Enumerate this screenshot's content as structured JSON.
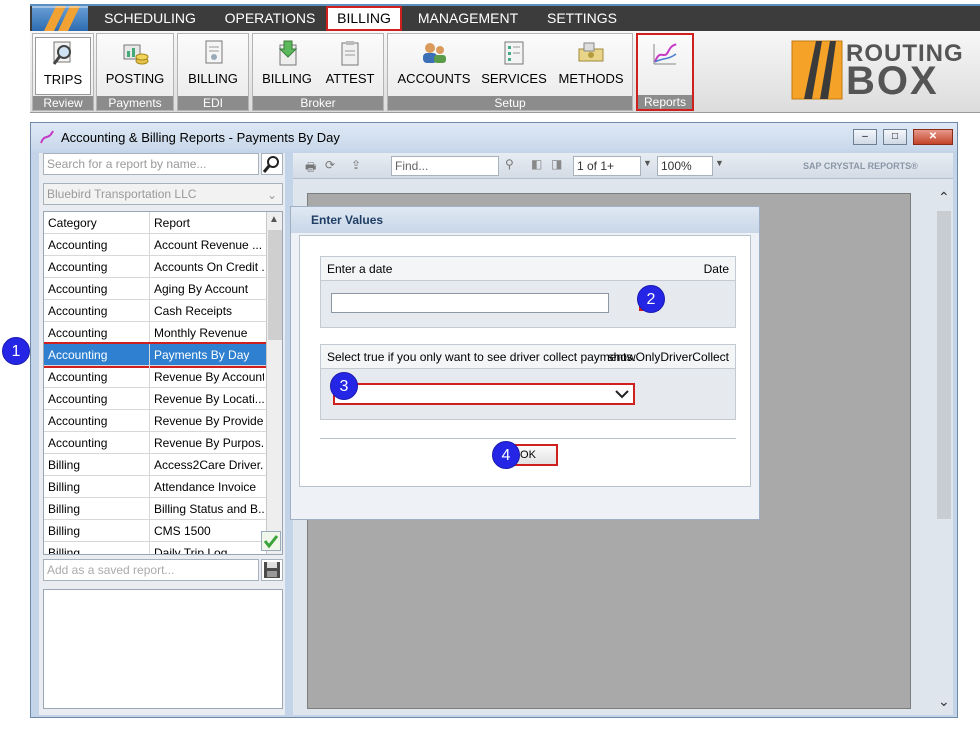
{
  "menu": {
    "items": [
      "SCHEDULING",
      "OPERATIONS",
      "BILLING",
      "MANAGEMENT",
      "SETTINGS"
    ],
    "active": "BILLING"
  },
  "ribbon": {
    "groups": [
      {
        "label": "Review",
        "buttons": [
          "TRIPS"
        ]
      },
      {
        "label": "Payments",
        "buttons": [
          "POSTING"
        ]
      },
      {
        "label": "EDI",
        "buttons": [
          "BILLING"
        ]
      },
      {
        "label": "Broker",
        "buttons": [
          "BILLING",
          "ATTEST"
        ]
      },
      {
        "label": "Setup",
        "buttons": [
          "ACCOUNTS",
          "SERVICES",
          "METHODS"
        ]
      },
      {
        "label": "Reports",
        "buttons": []
      }
    ]
  },
  "brand": {
    "line1": "ROUTING",
    "line2": "BOX"
  },
  "window": {
    "title": "Accounting & Billing Reports - Payments By Day"
  },
  "left": {
    "search_placeholder": "Search for a report by name...",
    "company": "Bluebird Transportation LLC",
    "columns": [
      "Category",
      "Report"
    ],
    "rows": [
      {
        "cat": "Accounting",
        "rep": "Account Revenue ..."
      },
      {
        "cat": "Accounting",
        "rep": "Accounts On Credit ..."
      },
      {
        "cat": "Accounting",
        "rep": "Aging By Account"
      },
      {
        "cat": "Accounting",
        "rep": "Cash Receipts"
      },
      {
        "cat": "Accounting",
        "rep": "Monthly Revenue"
      },
      {
        "cat": "Accounting",
        "rep": "Payments By Day"
      },
      {
        "cat": "Accounting",
        "rep": "Revenue By Account"
      },
      {
        "cat": "Accounting",
        "rep": "Revenue By Locati..."
      },
      {
        "cat": "Accounting",
        "rep": "Revenue By Provider"
      },
      {
        "cat": "Accounting",
        "rep": "Revenue By Purpos..."
      },
      {
        "cat": "Billing",
        "rep": "Access2Care Driver..."
      },
      {
        "cat": "Billing",
        "rep": "Attendance Invoice"
      },
      {
        "cat": "Billing",
        "rep": "Billing Status and B..."
      },
      {
        "cat": "Billing",
        "rep": "CMS 1500"
      },
      {
        "cat": "Billing",
        "rep": "Daily Trip Log"
      }
    ],
    "saved_placeholder": "Add as a saved report..."
  },
  "viewer": {
    "find_placeholder": "Find...",
    "page": "1 of 1+",
    "zoom": "100%",
    "brand": "SAP CRYSTAL REPORTS®"
  },
  "dialog": {
    "title": "Enter Values",
    "param1": {
      "label": "Enter a date",
      "type": "Date",
      "value": ""
    },
    "param2": {
      "label": "Select true if you only want to see driver collect payments.",
      "name": "showOnlyDriverCollect",
      "value": "..."
    },
    "ok": "OK"
  },
  "badges": [
    "1",
    "2",
    "3",
    "4"
  ]
}
